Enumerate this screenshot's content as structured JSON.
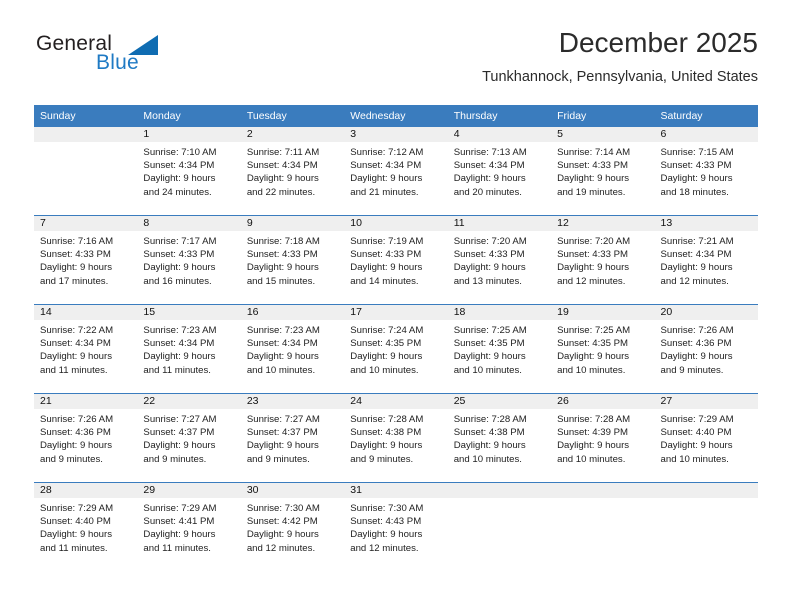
{
  "brand": {
    "name_part1": "General",
    "name_part2": "Blue",
    "triangle_color": "#0f6cb2",
    "blue_text_color": "#1f7ac4"
  },
  "header": {
    "title": "December 2025",
    "subtitle": "Tunkhannock, Pennsylvania, United States"
  },
  "theme": {
    "header_bar_color": "#3a7cbe",
    "daynum_band_color": "#efefef",
    "cell_background": "#ffffff",
    "row_divider_color": "#3a7cbe"
  },
  "weekdays": [
    "Sunday",
    "Monday",
    "Tuesday",
    "Wednesday",
    "Thursday",
    "Friday",
    "Saturday"
  ],
  "weeks": [
    [
      {
        "day": "",
        "sunrise": "",
        "sunset": "",
        "daylight_line1": "",
        "daylight_line2": "",
        "blank": true
      },
      {
        "day": "1",
        "sunrise": "Sunrise: 7:10 AM",
        "sunset": "Sunset: 4:34 PM",
        "daylight_line1": "Daylight: 9 hours",
        "daylight_line2": "and 24 minutes."
      },
      {
        "day": "2",
        "sunrise": "Sunrise: 7:11 AM",
        "sunset": "Sunset: 4:34 PM",
        "daylight_line1": "Daylight: 9 hours",
        "daylight_line2": "and 22 minutes."
      },
      {
        "day": "3",
        "sunrise": "Sunrise: 7:12 AM",
        "sunset": "Sunset: 4:34 PM",
        "daylight_line1": "Daylight: 9 hours",
        "daylight_line2": "and 21 minutes."
      },
      {
        "day": "4",
        "sunrise": "Sunrise: 7:13 AM",
        "sunset": "Sunset: 4:34 PM",
        "daylight_line1": "Daylight: 9 hours",
        "daylight_line2": "and 20 minutes."
      },
      {
        "day": "5",
        "sunrise": "Sunrise: 7:14 AM",
        "sunset": "Sunset: 4:33 PM",
        "daylight_line1": "Daylight: 9 hours",
        "daylight_line2": "and 19 minutes."
      },
      {
        "day": "6",
        "sunrise": "Sunrise: 7:15 AM",
        "sunset": "Sunset: 4:33 PM",
        "daylight_line1": "Daylight: 9 hours",
        "daylight_line2": "and 18 minutes."
      }
    ],
    [
      {
        "day": "7",
        "sunrise": "Sunrise: 7:16 AM",
        "sunset": "Sunset: 4:33 PM",
        "daylight_line1": "Daylight: 9 hours",
        "daylight_line2": "and 17 minutes."
      },
      {
        "day": "8",
        "sunrise": "Sunrise: 7:17 AM",
        "sunset": "Sunset: 4:33 PM",
        "daylight_line1": "Daylight: 9 hours",
        "daylight_line2": "and 16 minutes."
      },
      {
        "day": "9",
        "sunrise": "Sunrise: 7:18 AM",
        "sunset": "Sunset: 4:33 PM",
        "daylight_line1": "Daylight: 9 hours",
        "daylight_line2": "and 15 minutes."
      },
      {
        "day": "10",
        "sunrise": "Sunrise: 7:19 AM",
        "sunset": "Sunset: 4:33 PM",
        "daylight_line1": "Daylight: 9 hours",
        "daylight_line2": "and 14 minutes."
      },
      {
        "day": "11",
        "sunrise": "Sunrise: 7:20 AM",
        "sunset": "Sunset: 4:33 PM",
        "daylight_line1": "Daylight: 9 hours",
        "daylight_line2": "and 13 minutes."
      },
      {
        "day": "12",
        "sunrise": "Sunrise: 7:20 AM",
        "sunset": "Sunset: 4:33 PM",
        "daylight_line1": "Daylight: 9 hours",
        "daylight_line2": "and 12 minutes."
      },
      {
        "day": "13",
        "sunrise": "Sunrise: 7:21 AM",
        "sunset": "Sunset: 4:34 PM",
        "daylight_line1": "Daylight: 9 hours",
        "daylight_line2": "and 12 minutes."
      }
    ],
    [
      {
        "day": "14",
        "sunrise": "Sunrise: 7:22 AM",
        "sunset": "Sunset: 4:34 PM",
        "daylight_line1": "Daylight: 9 hours",
        "daylight_line2": "and 11 minutes."
      },
      {
        "day": "15",
        "sunrise": "Sunrise: 7:23 AM",
        "sunset": "Sunset: 4:34 PM",
        "daylight_line1": "Daylight: 9 hours",
        "daylight_line2": "and 11 minutes."
      },
      {
        "day": "16",
        "sunrise": "Sunrise: 7:23 AM",
        "sunset": "Sunset: 4:34 PM",
        "daylight_line1": "Daylight: 9 hours",
        "daylight_line2": "and 10 minutes."
      },
      {
        "day": "17",
        "sunrise": "Sunrise: 7:24 AM",
        "sunset": "Sunset: 4:35 PM",
        "daylight_line1": "Daylight: 9 hours",
        "daylight_line2": "and 10 minutes."
      },
      {
        "day": "18",
        "sunrise": "Sunrise: 7:25 AM",
        "sunset": "Sunset: 4:35 PM",
        "daylight_line1": "Daylight: 9 hours",
        "daylight_line2": "and 10 minutes."
      },
      {
        "day": "19",
        "sunrise": "Sunrise: 7:25 AM",
        "sunset": "Sunset: 4:35 PM",
        "daylight_line1": "Daylight: 9 hours",
        "daylight_line2": "and 10 minutes."
      },
      {
        "day": "20",
        "sunrise": "Sunrise: 7:26 AM",
        "sunset": "Sunset: 4:36 PM",
        "daylight_line1": "Daylight: 9 hours",
        "daylight_line2": "and 9 minutes."
      }
    ],
    [
      {
        "day": "21",
        "sunrise": "Sunrise: 7:26 AM",
        "sunset": "Sunset: 4:36 PM",
        "daylight_line1": "Daylight: 9 hours",
        "daylight_line2": "and 9 minutes."
      },
      {
        "day": "22",
        "sunrise": "Sunrise: 7:27 AM",
        "sunset": "Sunset: 4:37 PM",
        "daylight_line1": "Daylight: 9 hours",
        "daylight_line2": "and 9 minutes."
      },
      {
        "day": "23",
        "sunrise": "Sunrise: 7:27 AM",
        "sunset": "Sunset: 4:37 PM",
        "daylight_line1": "Daylight: 9 hours",
        "daylight_line2": "and 9 minutes."
      },
      {
        "day": "24",
        "sunrise": "Sunrise: 7:28 AM",
        "sunset": "Sunset: 4:38 PM",
        "daylight_line1": "Daylight: 9 hours",
        "daylight_line2": "and 9 minutes."
      },
      {
        "day": "25",
        "sunrise": "Sunrise: 7:28 AM",
        "sunset": "Sunset: 4:38 PM",
        "daylight_line1": "Daylight: 9 hours",
        "daylight_line2": "and 10 minutes."
      },
      {
        "day": "26",
        "sunrise": "Sunrise: 7:28 AM",
        "sunset": "Sunset: 4:39 PM",
        "daylight_line1": "Daylight: 9 hours",
        "daylight_line2": "and 10 minutes."
      },
      {
        "day": "27",
        "sunrise": "Sunrise: 7:29 AM",
        "sunset": "Sunset: 4:40 PM",
        "daylight_line1": "Daylight: 9 hours",
        "daylight_line2": "and 10 minutes."
      }
    ],
    [
      {
        "day": "28",
        "sunrise": "Sunrise: 7:29 AM",
        "sunset": "Sunset: 4:40 PM",
        "daylight_line1": "Daylight: 9 hours",
        "daylight_line2": "and 11 minutes."
      },
      {
        "day": "29",
        "sunrise": "Sunrise: 7:29 AM",
        "sunset": "Sunset: 4:41 PM",
        "daylight_line1": "Daylight: 9 hours",
        "daylight_line2": "and 11 minutes."
      },
      {
        "day": "30",
        "sunrise": "Sunrise: 7:30 AM",
        "sunset": "Sunset: 4:42 PM",
        "daylight_line1": "Daylight: 9 hours",
        "daylight_line2": "and 12 minutes."
      },
      {
        "day": "31",
        "sunrise": "Sunrise: 7:30 AM",
        "sunset": "Sunset: 4:43 PM",
        "daylight_line1": "Daylight: 9 hours",
        "daylight_line2": "and 12 minutes."
      },
      {
        "day": "",
        "sunrise": "",
        "sunset": "",
        "daylight_line1": "",
        "daylight_line2": "",
        "blank": true
      },
      {
        "day": "",
        "sunrise": "",
        "sunset": "",
        "daylight_line1": "",
        "daylight_line2": "",
        "blank": true
      },
      {
        "day": "",
        "sunrise": "",
        "sunset": "",
        "daylight_line1": "",
        "daylight_line2": "",
        "blank": true
      }
    ]
  ]
}
